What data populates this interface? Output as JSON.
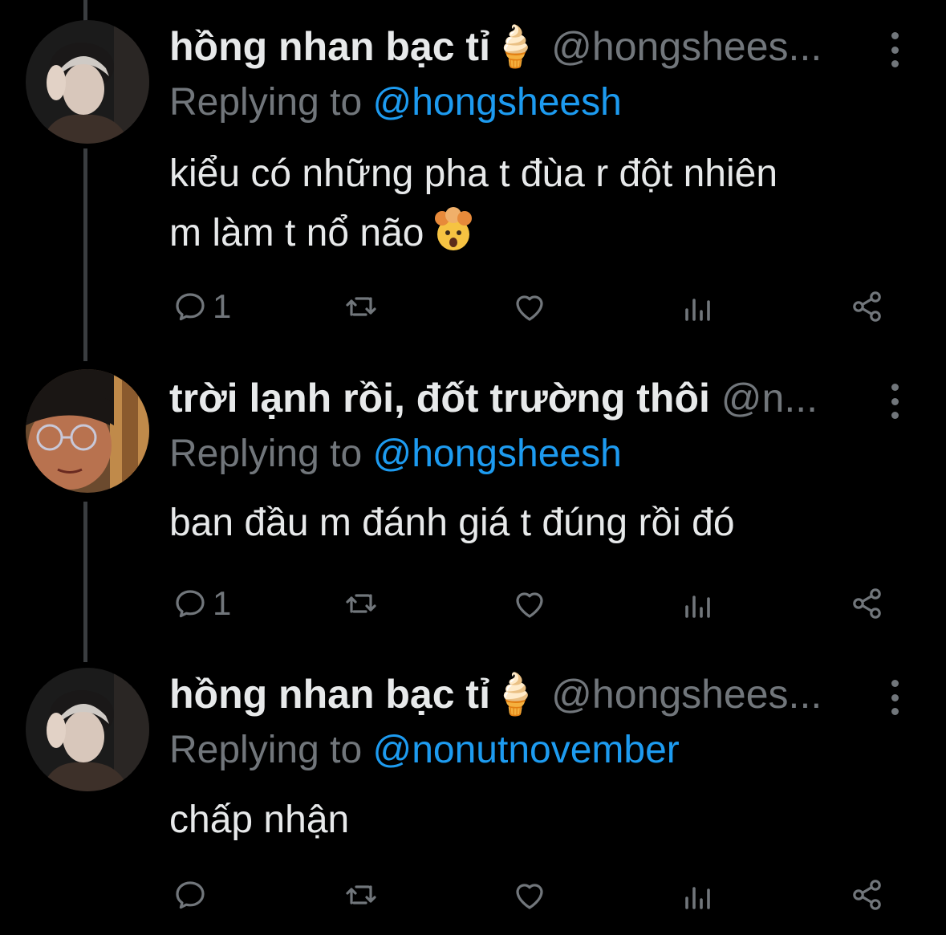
{
  "tweets": [
    {
      "name": "hồng nhan bạc tỉ🍦",
      "handle": "@hongshees...",
      "replying_prefix": "Replying to",
      "replying_to": "@hongsheesh",
      "text_lines": [
        "kiểu có những pha t đùa r đột nhiên",
        "m làm t nổ não"
      ],
      "emoji": "exploding-head-emoji",
      "reply_count": "1",
      "avatar": "avatar-photo-1"
    },
    {
      "name": "trời lạnh rồi, đốt trường thôi",
      "handle": "@n...",
      "replying_prefix": "Replying to",
      "replying_to": "@hongsheesh",
      "text_lines": [
        "ban đầu m đánh giá t đúng rồi đó"
      ],
      "reply_count": "1",
      "avatar": "avatar-photo-2"
    },
    {
      "name": "hồng nhan bạc tỉ🍦",
      "handle": "@hongshees...",
      "replying_prefix": "Replying to",
      "replying_to": "@nonutnovember",
      "text_lines": [
        "chấp nhận"
      ],
      "reply_count": "",
      "avatar": "avatar-photo-1"
    }
  ],
  "icons": {
    "reply": "reply-icon",
    "retweet": "retweet-icon",
    "like": "heart-icon",
    "views": "analytics-icon",
    "share": "share-icon",
    "more": "more-options-icon"
  },
  "colors": {
    "background": "#000000",
    "text": "#e7e9ea",
    "secondary": "#71767b",
    "link": "#1d9bf0",
    "thread_line": "#3a3d40"
  }
}
